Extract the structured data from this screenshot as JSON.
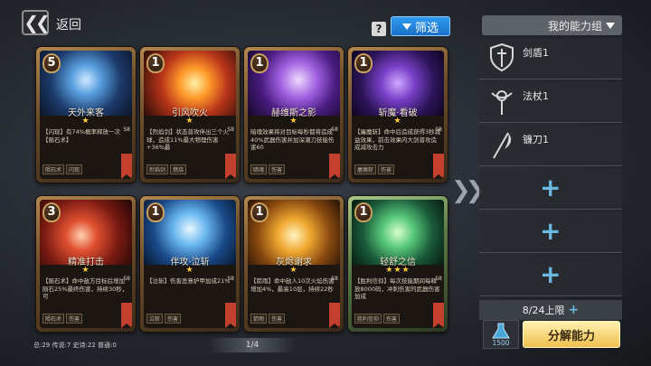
{
  "header": {
    "back_icon": "double-chevron-left-icon",
    "back_label": "返回",
    "help_icon": "question-icon",
    "filter_label": "筛选"
  },
  "cards": [
    {
      "cost": "5",
      "name": "天外来客",
      "stars": "★",
      "desc": "【闪现】有74%概率释放一次【陨石术】",
      "level": "S8",
      "tags": [
        "陨石术",
        "闪现"
      ],
      "art": "blue-figure"
    },
    {
      "cost": "1",
      "name": "引风吹火",
      "stars": "★",
      "desc": "【烈焰剑】状态普攻伴出三个火球，造成11%最大物理伤害+36%最",
      "level": "S8",
      "tags": [
        "烈焰剑",
        "燃烧"
      ],
      "art": "fire"
    },
    {
      "cost": "1",
      "name": "赫维斯之影",
      "stars": "★",
      "desc": "暗魂效果将对目标每秒都将造成40%武器伤害并加深潮刀技能伤害60",
      "level": "S8",
      "tags": [
        "暗魂",
        "伤害"
      ],
      "art": "purple"
    },
    {
      "cost": "1",
      "name": "斩魔·看破",
      "stars": "★",
      "desc": "【屠魔斩】命中后造成获得3秒减益效果，前击效果内大剑普攻造成减攻击力",
      "level": "S8",
      "tags": [
        "屠魔斩",
        "伤害"
      ],
      "art": "violet-warrior"
    },
    {
      "cost": "3",
      "name": "精准打击",
      "stars": "★",
      "desc": "【陨石术】命中敌方目标后增加陨石25%最终伤害，持续30秒，可",
      "level": "S8",
      "tags": [
        "陨石术",
        "伤害"
      ],
      "art": "red-rock"
    },
    {
      "cost": "1",
      "name": "伴攻·泣斩",
      "stars": "★",
      "desc": "【泣斩】伤害恶意护甲加成21%",
      "level": "S8",
      "tags": [
        "泣斩",
        "伤害"
      ],
      "art": "blue-knight"
    },
    {
      "cost": "1",
      "name": "灰烬谢求",
      "stars": "★",
      "desc": "【箭雨】命中敌人10次火焰伤害增加4%，最高10层，持续22秒",
      "level": "S8",
      "tags": [
        "箭雨",
        "伤害"
      ],
      "art": "gold-arrow"
    },
    {
      "cost": "1",
      "name": "轻舒之信",
      "stars": "★★★",
      "desc": "【胜利信仰】每次技能期间每释放8000码，冲刺伤害的武器伤害加成",
      "level": "S8",
      "tags": [
        "胜利信仰",
        "伤害"
      ],
      "art": "green-cube"
    }
  ],
  "footer": {
    "stats": "总:29 传说:7 史诗:22 普通:0",
    "pager": "1/4"
  },
  "side": {
    "arrow_icon": "double-chevron-right-icon",
    "title": "我的能力组",
    "slots": [
      {
        "label": "剑盾1",
        "icon": "sword-shield-icon"
      },
      {
        "label": "法杖1",
        "icon": "staff-icon"
      },
      {
        "label": "镰刀1",
        "icon": "scythe-icon"
      }
    ],
    "empty_slots": 3,
    "limit": "8/24上限",
    "resource": "1500",
    "dismantle": "分解能力"
  }
}
